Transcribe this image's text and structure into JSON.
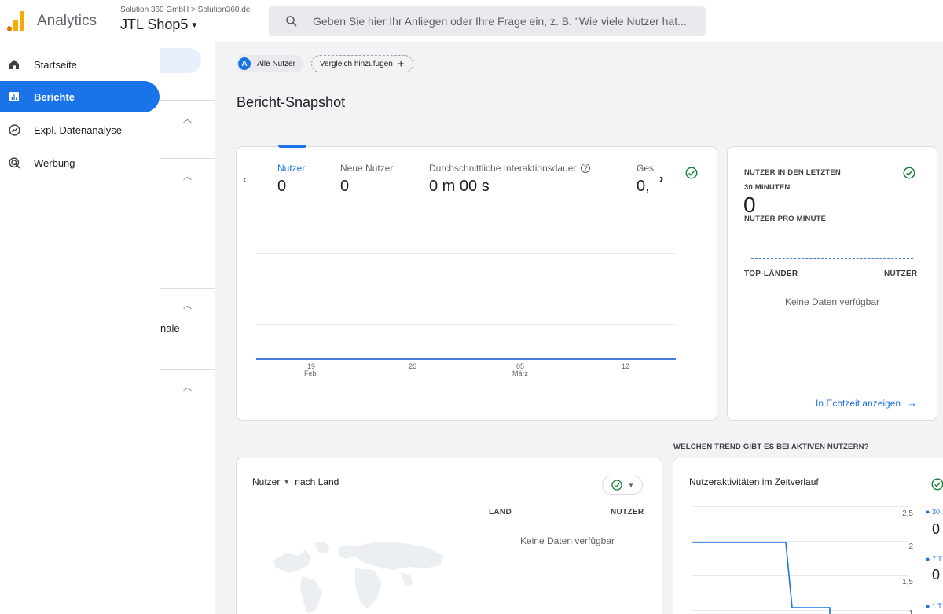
{
  "header": {
    "app_name": "Analytics",
    "account_path": "Solution 360 GmbH > Solution360.de",
    "property_name": "JTL Shop5",
    "search_placeholder": "Geben Sie hier Ihr Anliegen oder Ihre Frage ein, z. B. \"Wie viele Nutzer hat..."
  },
  "nav": {
    "items": [
      {
        "label": "Startseite",
        "icon": "home-icon",
        "active": false
      },
      {
        "label": "Berichte",
        "icon": "reports-icon",
        "active": true
      },
      {
        "label": "Expl. Datenanalyse",
        "icon": "explore-icon",
        "active": false
      },
      {
        "label": "Werbung",
        "icon": "advertising-icon",
        "active": false
      }
    ]
  },
  "subpanel": {
    "partial_text": "nale"
  },
  "main": {
    "segment_chip": "Alle Nutzer",
    "segment_avatar": "A",
    "compare_chip": "Vergleich hinzufügen",
    "page_title": "Bericht-Snapshot"
  },
  "overview_card": {
    "metrics": [
      {
        "label": "Nutzer",
        "value": "0",
        "selected": true
      },
      {
        "label": "Neue Nutzer",
        "value": "0",
        "selected": false
      },
      {
        "label": "Durchschnittliche Interaktionsdauer",
        "value": "0 m 00 s",
        "selected": false
      },
      {
        "label": "Ges",
        "value": "0,",
        "selected": false
      }
    ],
    "x_ticks": [
      {
        "day": "19",
        "month": "Feb."
      },
      {
        "day": "26",
        "month": ""
      },
      {
        "day": "05",
        "month": "März"
      },
      {
        "day": "12",
        "month": ""
      }
    ]
  },
  "realtime_card": {
    "title_line1": "NUTZER IN DEN LETZTEN",
    "title_line2": "30 MINUTEN",
    "value": "0",
    "per_minute_label": "NUTZER PRO MINUTE",
    "col_country": "TOP-LÄNDER",
    "col_users": "NUTZER",
    "no_data": "Keine Daten verfügbar",
    "link": "In Echtzeit anzeigen"
  },
  "section_label": "WELCHEN TREND GIBT ES BEI AKTIVEN NUTZERN?",
  "map_card": {
    "metric_dropdown": "Nutzer",
    "dimension": "nach Land",
    "col_country": "LAND",
    "col_users": "NUTZER",
    "no_data": "Keine Daten verfügbar"
  },
  "activity_card": {
    "title": "Nutzeraktivitäten im Zeitverlauf",
    "y_ticks": [
      "2,5",
      "2",
      "1,5",
      "1"
    ],
    "legend": [
      {
        "label": "30",
        "value": "0"
      },
      {
        "label": "7 T",
        "value": "0"
      },
      {
        "label": "1 T",
        "value": ""
      }
    ]
  },
  "colors": {
    "accent": "#1a73e8",
    "check_green": "#188038",
    "logo_orange": "#f9ab00",
    "logo_dark_orange": "#e37400"
  }
}
